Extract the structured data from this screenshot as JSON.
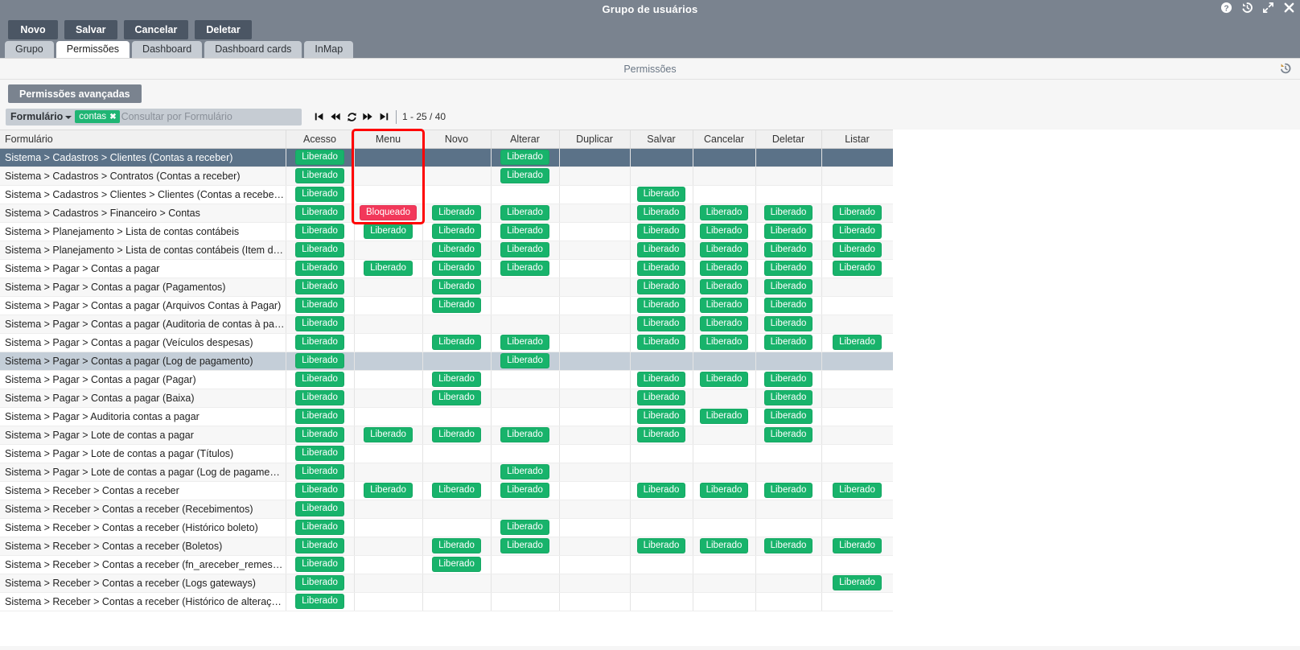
{
  "window": {
    "title": "Grupo de usuários",
    "icons": [
      {
        "name": "help-icon",
        "glyph": "?"
      },
      {
        "name": "history-icon",
        "glyph": "history"
      },
      {
        "name": "expand-icon",
        "glyph": "expand"
      },
      {
        "name": "close-icon",
        "glyph": "x"
      }
    ]
  },
  "toolbar": {
    "buttons": [
      {
        "label": "Novo",
        "name": "novo-button"
      },
      {
        "label": "Salvar",
        "name": "salvar-button"
      },
      {
        "label": "Cancelar",
        "name": "cancelar-button"
      },
      {
        "label": "Deletar",
        "name": "deletar-button"
      }
    ]
  },
  "tabs": [
    {
      "label": "Grupo",
      "active": false
    },
    {
      "label": "Permissões",
      "active": true
    },
    {
      "label": "Dashboard",
      "active": false
    },
    {
      "label": "Dashboard cards",
      "active": false
    },
    {
      "label": "InMap",
      "active": false
    }
  ],
  "section": {
    "title": "Permissões",
    "restore_icon": "history-restore-icon"
  },
  "advanced": {
    "label": "Permissões avançadas"
  },
  "search": {
    "field_label": "Formulário",
    "chip": "contas",
    "chip_remove": "✖",
    "placeholder": "Consultar por Formulário",
    "value": ""
  },
  "pagination": {
    "first": "⏮",
    "prev": "⏪",
    "refresh": "⟳",
    "next": "⏩",
    "last": "⏭",
    "count": "1 - 25 / 40"
  },
  "highlight": {
    "color": "#ff0000",
    "target_column": "Menu"
  },
  "table": {
    "columns": [
      "Formulário",
      "Acesso",
      "Menu",
      "Novo",
      "Alterar",
      "Duplicar",
      "Salvar",
      "Cancelar",
      "Deletar",
      "Listar"
    ],
    "badge_allow": "Liberado",
    "badge_block": "Bloqueado",
    "rows": [
      {
        "form": "Sistema > Cadastros > Clientes (Contas a receber)",
        "state": "selected",
        "cells": [
          "ok",
          "",
          "",
          "ok",
          "",
          "",
          "",
          "",
          ""
        ]
      },
      {
        "form": "Sistema > Cadastros > Contratos (Contas a receber)",
        "state": "even",
        "cells": [
          "ok",
          "",
          "",
          "ok",
          "",
          "",
          "",
          "",
          ""
        ]
      },
      {
        "form": "Sistema > Cadastros > Clientes > Clientes (Contas a receber (Imprimi…",
        "state": "odd",
        "cells": [
          "ok",
          "",
          "",
          "",
          "",
          "ok",
          "",
          "",
          ""
        ]
      },
      {
        "form": "Sistema > Cadastros > Financeiro > Contas",
        "state": "even",
        "cells": [
          "ok",
          "block",
          "ok",
          "ok",
          "",
          "ok",
          "ok",
          "ok",
          "ok"
        ]
      },
      {
        "form": "Sistema > Planejamento > Lista de contas contábeis",
        "state": "odd",
        "cells": [
          "ok",
          "ok",
          "ok",
          "ok",
          "",
          "ok",
          "ok",
          "ok",
          "ok"
        ]
      },
      {
        "form": "Sistema > Planejamento > Lista de contas contábeis (Item da lista de …",
        "state": "even",
        "cells": [
          "ok",
          "",
          "ok",
          "ok",
          "",
          "ok",
          "ok",
          "ok",
          "ok"
        ]
      },
      {
        "form": "Sistema > Pagar > Contas a pagar",
        "state": "odd",
        "cells": [
          "ok",
          "ok",
          "ok",
          "ok",
          "",
          "ok",
          "ok",
          "ok",
          "ok"
        ]
      },
      {
        "form": "Sistema > Pagar > Contas a pagar (Pagamentos)",
        "state": "even",
        "cells": [
          "ok",
          "",
          "ok",
          "",
          "",
          "ok",
          "ok",
          "ok",
          ""
        ]
      },
      {
        "form": "Sistema > Pagar > Contas a pagar (Arquivos Contas à Pagar)",
        "state": "odd",
        "cells": [
          "ok",
          "",
          "ok",
          "",
          "",
          "ok",
          "ok",
          "ok",
          ""
        ]
      },
      {
        "form": "Sistema > Pagar > Contas a pagar (Auditoria de contas à pagar)",
        "state": "even",
        "cells": [
          "ok",
          "",
          "",
          "",
          "",
          "ok",
          "ok",
          "ok",
          ""
        ]
      },
      {
        "form": "Sistema > Pagar > Contas a pagar (Veículos despesas)",
        "state": "odd",
        "cells": [
          "ok",
          "",
          "ok",
          "ok",
          "",
          "ok",
          "ok",
          "ok",
          "ok"
        ]
      },
      {
        "form": "Sistema > Pagar > Contas a pagar (Log de pagamento)",
        "state": "hover",
        "cells": [
          "ok",
          "",
          "",
          "ok",
          "",
          "",
          "",
          "",
          ""
        ]
      },
      {
        "form": "Sistema > Pagar > Contas a pagar (Pagar)",
        "state": "odd",
        "cells": [
          "ok",
          "",
          "ok",
          "",
          "",
          "ok",
          "ok",
          "ok",
          ""
        ]
      },
      {
        "form": "Sistema > Pagar > Contas a pagar (Baixa)",
        "state": "even",
        "cells": [
          "ok",
          "",
          "ok",
          "",
          "",
          "ok",
          "",
          "ok",
          ""
        ]
      },
      {
        "form": "Sistema > Pagar > Auditoria contas a pagar",
        "state": "odd",
        "cells": [
          "ok",
          "",
          "",
          "",
          "",
          "ok",
          "ok",
          "ok",
          ""
        ]
      },
      {
        "form": "Sistema > Pagar > Lote de contas a pagar",
        "state": "even",
        "cells": [
          "ok",
          "ok",
          "ok",
          "ok",
          "",
          "ok",
          "",
          "ok",
          ""
        ]
      },
      {
        "form": "Sistema > Pagar > Lote de contas a pagar (Títulos)",
        "state": "odd",
        "cells": [
          "ok",
          "",
          "",
          "",
          "",
          "",
          "",
          "",
          ""
        ]
      },
      {
        "form": "Sistema > Pagar > Lote de contas a pagar (Log de pagamento)",
        "state": "even",
        "cells": [
          "ok",
          "",
          "",
          "ok",
          "",
          "",
          "",
          "",
          ""
        ]
      },
      {
        "form": "Sistema > Receber > Contas a receber",
        "state": "odd",
        "cells": [
          "ok",
          "ok",
          "ok",
          "ok",
          "",
          "ok",
          "ok",
          "ok",
          "ok"
        ]
      },
      {
        "form": "Sistema > Receber > Contas a receber (Recebimentos)",
        "state": "even",
        "cells": [
          "ok",
          "",
          "",
          "",
          "",
          "",
          "",
          "",
          ""
        ]
      },
      {
        "form": "Sistema > Receber > Contas a receber (Histórico boleto)",
        "state": "odd",
        "cells": [
          "ok",
          "",
          "",
          "ok",
          "",
          "",
          "",
          "",
          ""
        ]
      },
      {
        "form": "Sistema > Receber > Contas a receber (Boletos)",
        "state": "even",
        "cells": [
          "ok",
          "",
          "ok",
          "ok",
          "",
          "ok",
          "ok",
          "ok",
          "ok"
        ]
      },
      {
        "form": "Sistema > Receber > Contas a receber (fn_areceber_remessas_v)",
        "state": "odd",
        "cells": [
          "ok",
          "",
          "ok",
          "",
          "",
          "",
          "",
          "",
          ""
        ]
      },
      {
        "form": "Sistema > Receber > Contas a receber (Logs gateways)",
        "state": "even",
        "cells": [
          "ok",
          "",
          "",
          "",
          "",
          "",
          "",
          "",
          "ok"
        ]
      },
      {
        "form": "Sistema > Receber > Contas a receber (Histórico de alterações de ca…",
        "state": "odd",
        "cells": [
          "ok",
          "",
          "",
          "",
          "",
          "",
          "",
          "",
          ""
        ]
      }
    ]
  }
}
